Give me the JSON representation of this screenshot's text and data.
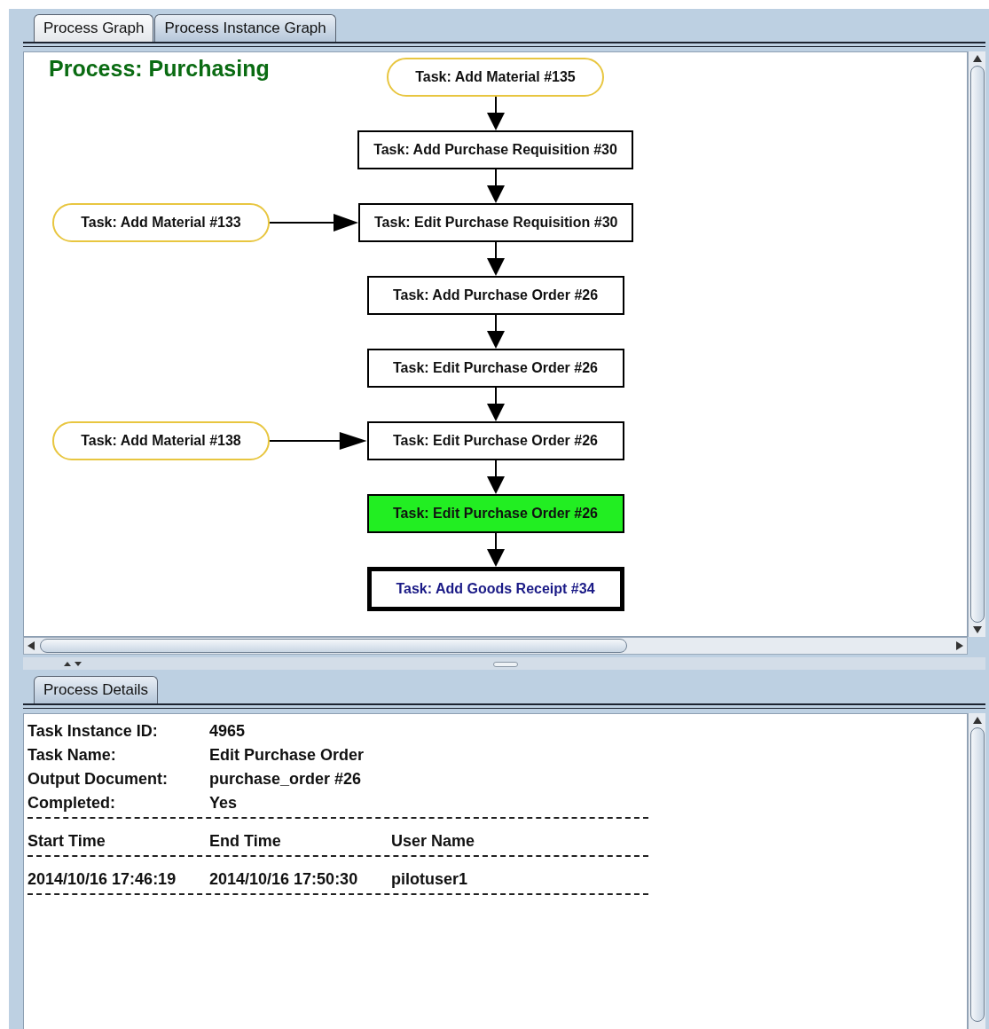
{
  "tabs": [
    {
      "label": "Process Graph",
      "selected": false
    },
    {
      "label": "Process Instance Graph",
      "selected": true
    }
  ],
  "process_graph": {
    "title": "Process: Purchasing",
    "nodes": [
      {
        "label": "Task: Add Material #135",
        "kind": "material",
        "highlighted": false,
        "pending": false
      },
      {
        "label": "Task: Add Purchase Requisition #30",
        "kind": "task",
        "highlighted": false,
        "pending": false
      },
      {
        "label": "Task: Edit Purchase Requisition #30",
        "kind": "task",
        "highlighted": false,
        "pending": false,
        "input": {
          "label": "Task: Add Material #133"
        }
      },
      {
        "label": "Task: Add Purchase Order #26",
        "kind": "task",
        "highlighted": false,
        "pending": false
      },
      {
        "label": "Task: Edit Purchase Order #26",
        "kind": "task",
        "highlighted": false,
        "pending": false
      },
      {
        "label": "Task: Edit Purchase Order #26",
        "kind": "task",
        "highlighted": false,
        "pending": false,
        "input": {
          "label": "Task: Add Material #138"
        }
      },
      {
        "label": "Task: Edit Purchase Order #26",
        "kind": "task",
        "highlighted": true,
        "pending": false
      },
      {
        "label": "Task: Add Goods Receipt #34",
        "kind": "task",
        "highlighted": false,
        "pending": true
      }
    ]
  },
  "details_tabs": [
    {
      "label": "Process Details",
      "selected": true
    }
  ],
  "details": {
    "fields": [
      {
        "label": "Task Instance ID:",
        "value": "4965"
      },
      {
        "label": "Task Name:",
        "value": "Edit Purchase Order"
      },
      {
        "label": "Output Document:",
        "value": "purchase_order #26"
      },
      {
        "label": "Completed:",
        "value": "Yes"
      }
    ],
    "columns": [
      "Start Time",
      "End Time",
      "User Name"
    ],
    "rows": [
      [
        "2014/10/16 17:46:19",
        "2014/10/16 17:50:30",
        "pilotuser1"
      ]
    ]
  }
}
